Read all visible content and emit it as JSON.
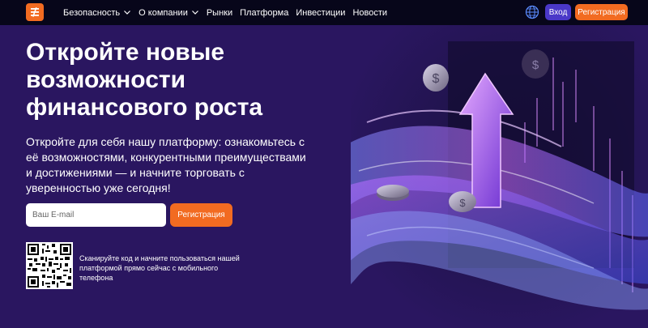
{
  "header": {
    "nav": [
      {
        "label": "Безопасность",
        "has_dropdown": true
      },
      {
        "label": "О компании",
        "has_dropdown": true
      },
      {
        "label": "Рынки",
        "has_dropdown": false
      },
      {
        "label": "Платформа",
        "has_dropdown": false
      },
      {
        "label": "Инвестиции",
        "has_dropdown": false
      },
      {
        "label": "Новости",
        "has_dropdown": false
      }
    ],
    "login_label": "Вход",
    "register_label": "Регистрация"
  },
  "hero": {
    "title_lines": [
      "Откройте новые",
      "возможности",
      "финансового роста"
    ],
    "description": "Откройте для себя нашу платформу: ознакомьтесь с её возможностями, конкурентными преимуществами и достижениями — и начните торговать с уверенностью уже сегодня!",
    "email_placeholder": "Ваш E-mail",
    "register_label": "Регистрация",
    "qr_text": "Сканируйте код и начните пользоваться нашей платформой прямо сейчас с мобильного телефона"
  },
  "icons": {
    "logo": "logo-icon",
    "globe": "globe-icon",
    "chevron": "chevron-down-icon",
    "qr": "qr-code-icon"
  },
  "colors": {
    "background": "#2a1660",
    "topbar": "#07061a",
    "accent_orange": "#f26b21",
    "login_button": "#4a38c8"
  }
}
